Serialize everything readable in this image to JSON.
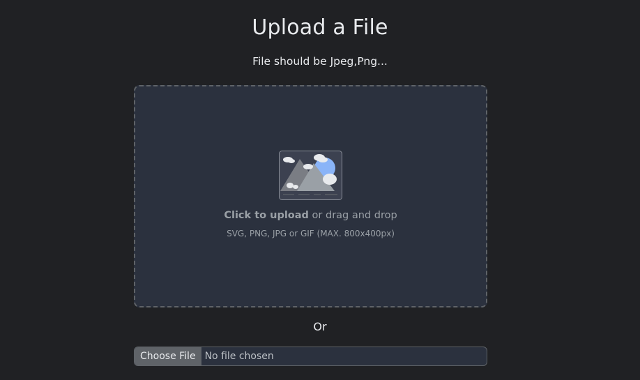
{
  "page": {
    "title": "Upload a File",
    "subtitle": "File should be Jpeg,Png..."
  },
  "dropzone": {
    "action_label": "Click to upload",
    "action_suffix": " or drag and drop",
    "hint": "SVG, PNG, JPG or GIF (MAX. 800x400px)",
    "illustration_icon": "image-placeholder-icon"
  },
  "separator": {
    "label": "Or"
  },
  "file_input": {
    "button_label": "Choose File",
    "status": "No file chosen"
  },
  "colors": {
    "background": "#202124",
    "dropzone_bg": "#2b313e",
    "border": "#5f6368",
    "text_primary": "#e8eaed",
    "text_muted": "#9aa0a6"
  }
}
